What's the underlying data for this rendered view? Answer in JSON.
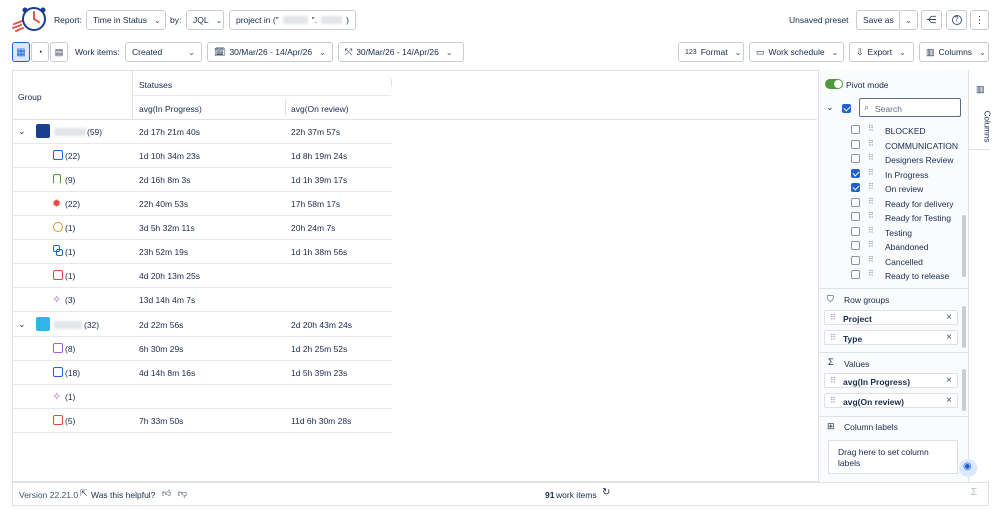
{
  "toolbar": {
    "report_label": "Report:",
    "report_value": "Time in Status",
    "by_label": "by:",
    "by_value": "JQL",
    "query_prefix": "project in (\"",
    "query_mid": "\".",
    "query_suffix": ")",
    "unsaved": "Unsaved preset",
    "save_as": "Save as"
  },
  "filters": {
    "work_items_label": "Work items:",
    "work_items_value": "Created",
    "date_range_1": "30/Mar/26 - 14/Apr/26",
    "date_range_2": "30/Mar/26 - 14/Apr/26",
    "format": "Format",
    "work_schedule": "Work schedule",
    "export": "Export",
    "columns": "Columns"
  },
  "table": {
    "group_header": "Group",
    "statuses_header": "Statuses",
    "col1": "avg(In Progress)",
    "col2": "avg(On review)",
    "rows": [
      {
        "label": "(59)",
        "c1": "2d 17h 21m 40s",
        "c2": "22h 37m 57s"
      },
      {
        "label": "(22)",
        "c1": "1d 10h 34m 23s",
        "c2": "1d 8h 19m 24s"
      },
      {
        "label": "(9)",
        "c1": "2d 16h 8m 3s",
        "c2": "1d 1h 39m 17s"
      },
      {
        "label": "(22)",
        "c1": "22h 40m 53s",
        "c2": "17h 58m 17s"
      },
      {
        "label": "(1)",
        "c1": "3d 5h 32m 11s",
        "c2": "20h 24m 7s"
      },
      {
        "label": "(1)",
        "c1": "23h 52m 19s",
        "c2": "1d 1h 38m 56s"
      },
      {
        "label": "(1)",
        "c1": "4d 20h 13m 25s",
        "c2": ""
      },
      {
        "label": "(3)",
        "c1": "13d 14h 4m 7s",
        "c2": ""
      },
      {
        "label": "(32)",
        "c1": "2d 22m 56s",
        "c2": "2d 20h 43m 24s"
      },
      {
        "label": "(8)",
        "c1": "6h 30m 29s",
        "c2": "1d 2h 25m 52s"
      },
      {
        "label": "(18)",
        "c1": "4d 14h 8m 16s",
        "c2": "1d 5h 39m 23s"
      },
      {
        "label": "(1)",
        "c1": "",
        "c2": ""
      },
      {
        "label": "(5)",
        "c1": "7h 33m 50s",
        "c2": "11d 6h 30m 28s"
      }
    ]
  },
  "footer": {
    "version": "Version 22.21.0",
    "helpful": "Was this helpful?",
    "count": "91",
    "count_label": "work items"
  },
  "panel": {
    "pivot_mode": "Pivot mode",
    "search_placeholder": "Search",
    "statuses": [
      {
        "name": "BLOCKED",
        "checked": false
      },
      {
        "name": "COMMUNICATION",
        "checked": false
      },
      {
        "name": "Designers Review",
        "checked": false
      },
      {
        "name": "In Progress",
        "checked": true
      },
      {
        "name": "On review",
        "checked": true
      },
      {
        "name": "Ready for delivery",
        "checked": false
      },
      {
        "name": "Ready for Testing",
        "checked": false
      },
      {
        "name": "Testing",
        "checked": false
      },
      {
        "name": "Abandoned",
        "checked": false
      },
      {
        "name": "Cancelled",
        "checked": false
      },
      {
        "name": "Ready to release",
        "checked": false
      }
    ],
    "row_groups_title": "Row groups",
    "row_groups": [
      "Project",
      "Type"
    ],
    "values_title": "Values",
    "values": [
      "avg(In Progress)",
      "avg(On review)"
    ],
    "column_labels_title": "Column labels",
    "drop_hint": "Drag here to set column labels",
    "side_tab": "Columns"
  },
  "colors": {
    "accent": "#1d63d6",
    "toggle": "#4c9a3a"
  }
}
